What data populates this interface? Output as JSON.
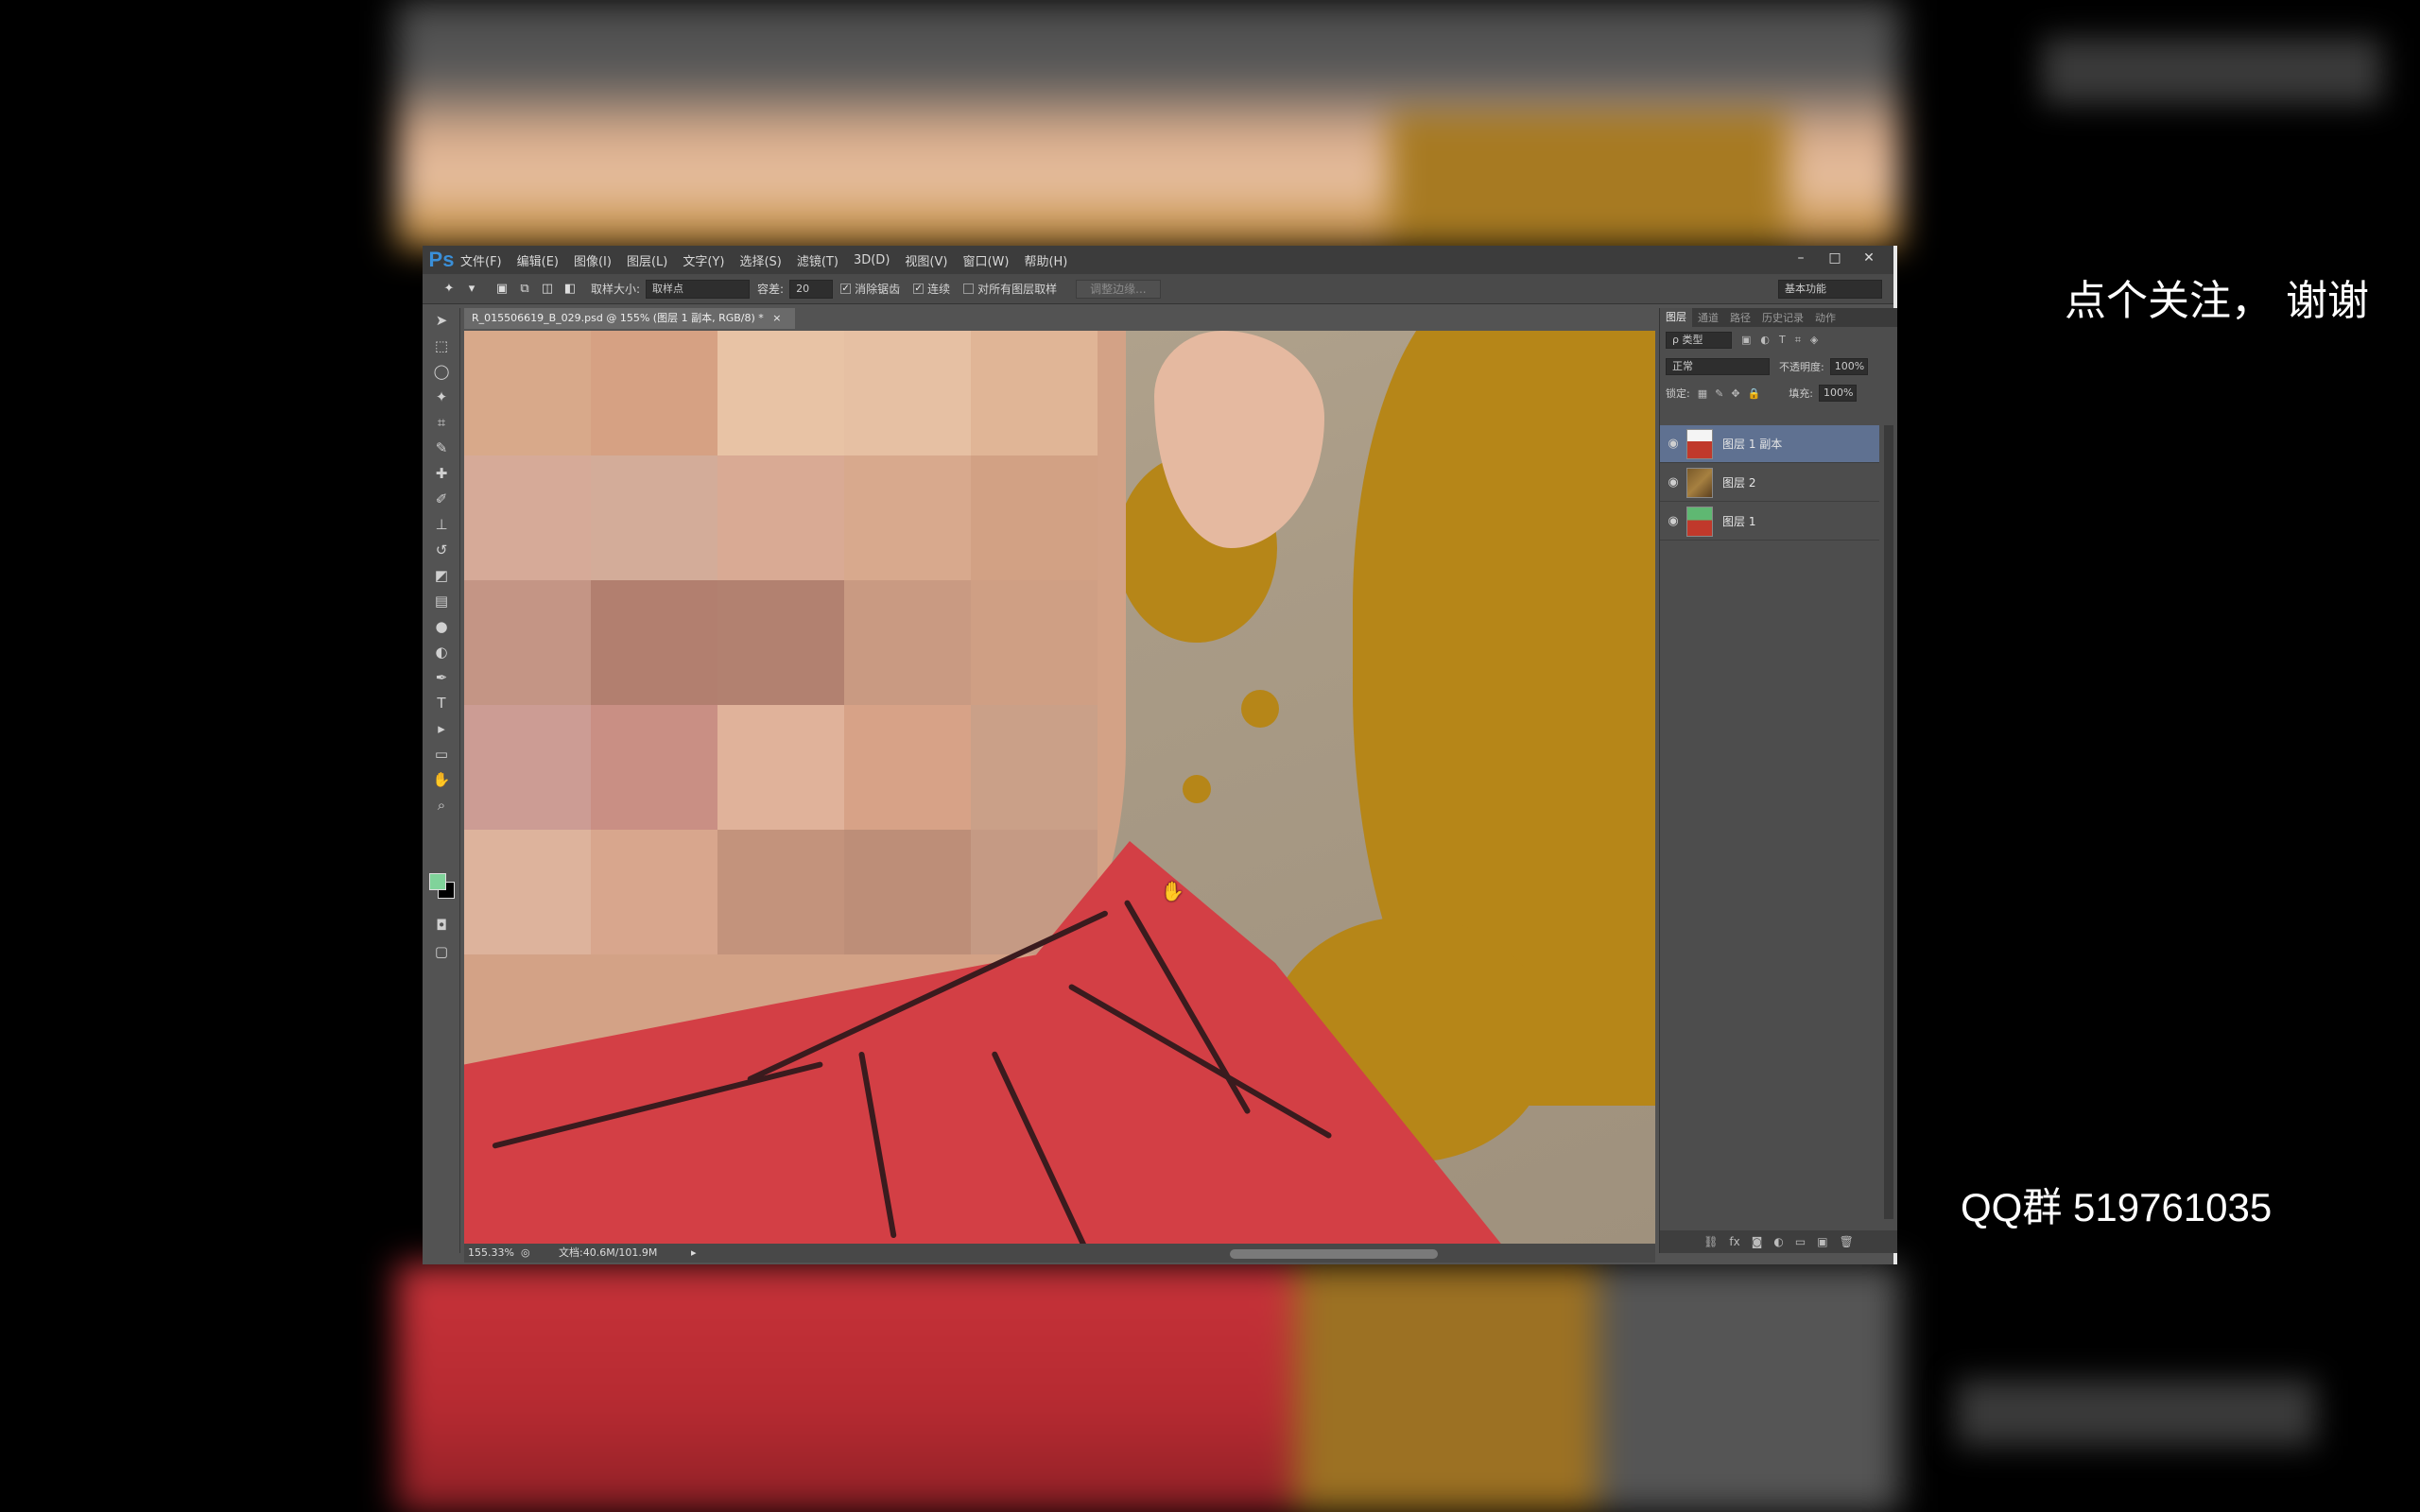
{
  "window": {
    "app_logo": "Ps",
    "menu": [
      "文件(F)",
      "编辑(E)",
      "图像(I)",
      "图层(L)",
      "文字(Y)",
      "选择(S)",
      "滤镜(T)",
      "3D(D)",
      "视图(V)",
      "窗口(W)",
      "帮助(H)"
    ],
    "controls": [
      "–",
      "□",
      "✕"
    ]
  },
  "options_bar": {
    "sample_size_label": "取样大小:",
    "sample_size_value": "取样点",
    "tolerance_label": "容差:",
    "tolerance_value": "20",
    "antialias_label": "消除锯齿",
    "contiguous_label": "连续",
    "sample_all_label": "对所有图层取样",
    "refine_button": "调整边缘...",
    "workspace": "基本功能"
  },
  "document": {
    "tab_title": "R_015506619_B_029.psd @ 155% (图层 1 副本, RGB/8) *",
    "zoom": "155.33%",
    "doc_size": "文档:40.6M/101.9M"
  },
  "layers_panel": {
    "tabs": [
      "图层",
      "通道",
      "路径",
      "历史记录",
      "动作"
    ],
    "filter_kind": "ρ 类型",
    "blend_mode": "正常",
    "opacity_label": "不透明度:",
    "opacity_value": "100%",
    "lock_label": "锁定:",
    "fill_label": "填充:",
    "fill_value": "100%",
    "layers": [
      {
        "name": "图层 1 副本",
        "selected": true
      },
      {
        "name": "图层 2",
        "selected": false
      },
      {
        "name": "图层 1",
        "selected": false
      }
    ]
  },
  "tools": [
    "move",
    "marquee",
    "lasso",
    "magic-wand",
    "crop",
    "eyedropper",
    "healing",
    "brush",
    "stamp",
    "history-brush",
    "eraser",
    "gradient",
    "blur",
    "dodge",
    "pen",
    "type",
    "path-select",
    "shape",
    "hand",
    "zoom"
  ],
  "colors": {
    "foreground": "#80d39a",
    "background": "#000000",
    "selected_layer": "#5f7191"
  },
  "overlay": {
    "follow_text": "点个关注， 谢谢",
    "qq_text": "QQ群  519761035"
  }
}
